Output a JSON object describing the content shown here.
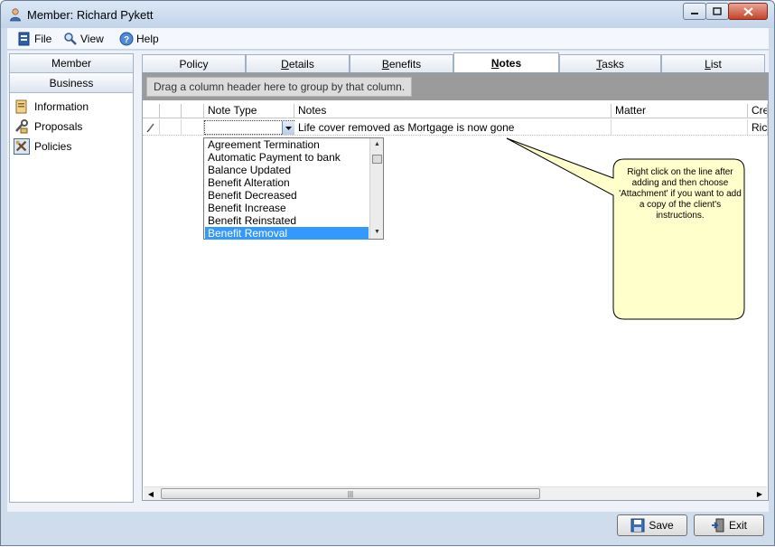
{
  "window": {
    "title": "Member: Richard Pykett"
  },
  "menu": {
    "file": "File",
    "view": "View",
    "help": "Help"
  },
  "nav": {
    "tabs": [
      "Member",
      "Business"
    ],
    "items": [
      "Information",
      "Proposals",
      "Policies"
    ]
  },
  "tabs": {
    "policy": "Policy",
    "details_pre": "",
    "details_u": "D",
    "details_post": "etails",
    "benefits_pre": "",
    "benefits_u": "B",
    "benefits_post": "enefits",
    "notes_pre": "",
    "notes_u": "N",
    "notes_post": "otes",
    "tasks_pre": "",
    "tasks_u": "T",
    "tasks_post": "asks",
    "list_pre": "",
    "list_u": "L",
    "list_post": "ist"
  },
  "grid": {
    "group_hint": "Drag a column header here to group by that column.",
    "columns": {
      "note_type": "Note Type",
      "notes": "Notes",
      "matter": "Matter",
      "created": "Crea"
    },
    "row": {
      "notes": "Life cover removed as Mortgage is now gone",
      "created": "Rich"
    }
  },
  "dropdown": {
    "options": [
      "Agreement Termination",
      "Automatic Payment to bank",
      "Balance Updated",
      "Benefit Alteration",
      "Benefit Decreased",
      "Benefit Increase",
      "Benefit Reinstated",
      "Benefit Removal"
    ],
    "selected_index": 7
  },
  "callout": {
    "text": "Right click on the line after adding and then choose 'Attachment' if you want to add a copy of the client's instructions."
  },
  "buttons": {
    "save": "Save",
    "exit": "Exit"
  }
}
